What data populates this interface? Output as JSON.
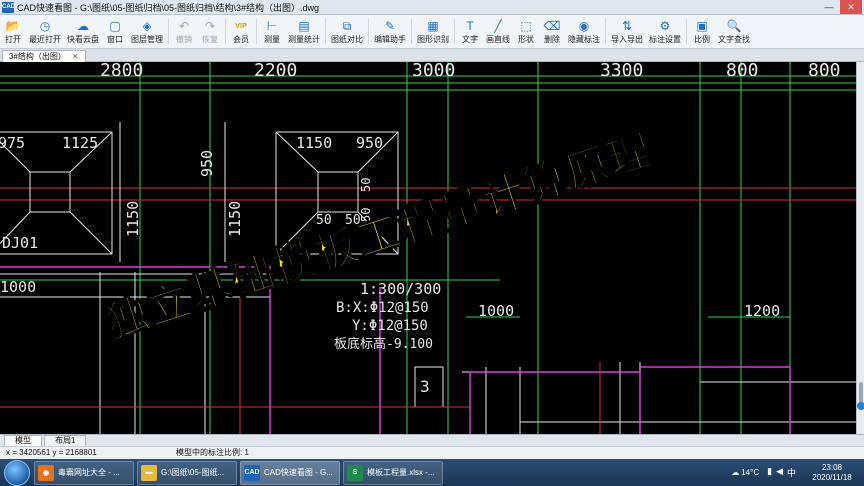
{
  "window": {
    "logo_text": "CAD",
    "title": "CAD快速看图 - G:\\图纸\\05-图纸归档\\05-图纸归档\\结构\\3#结构（出图）.dwg",
    "minimize": "—",
    "close": "✕"
  },
  "toolbar": {
    "items": [
      {
        "label": "打开",
        "icon": "folder-open-icon",
        "glyph": "📂"
      },
      {
        "label": "最近打开",
        "icon": "recent-icon",
        "glyph": "◷"
      },
      {
        "label": "快看云盘",
        "icon": "cloud-icon",
        "glyph": "☁"
      },
      {
        "label": "窗口",
        "icon": "window-icon",
        "glyph": "▢"
      },
      {
        "label": "图层管理",
        "icon": "layers-icon",
        "glyph": "◈"
      },
      {
        "label": "撤销",
        "icon": "undo-icon",
        "glyph": "↶",
        "disabled": true
      },
      {
        "label": "恢复",
        "icon": "redo-icon",
        "glyph": "↷",
        "disabled": true
      },
      {
        "label": "会员",
        "icon": "vip-icon",
        "glyph": "VIP"
      },
      {
        "label": "测量",
        "icon": "measure-icon",
        "glyph": "⊢"
      },
      {
        "label": "测量统计",
        "icon": "measure-stats-icon",
        "glyph": "▤"
      },
      {
        "label": "图纸对比",
        "icon": "compare-icon",
        "glyph": "⧉"
      },
      {
        "label": "编辑助手",
        "icon": "edit-helper-icon",
        "glyph": "✎"
      },
      {
        "label": "图形识别",
        "icon": "shape-recognize-icon",
        "glyph": "▦"
      },
      {
        "label": "文字",
        "icon": "text-icon",
        "glyph": "T"
      },
      {
        "label": "画直线",
        "icon": "line-icon",
        "glyph": "╱"
      },
      {
        "label": "形状",
        "icon": "shape-icon",
        "glyph": "⬚"
      },
      {
        "label": "删除",
        "icon": "eraser-icon",
        "glyph": "⌫"
      },
      {
        "label": "隐藏标注",
        "icon": "hide-annotation-icon",
        "glyph": "◉"
      },
      {
        "label": "导入导出",
        "icon": "import-export-icon",
        "glyph": "⇅"
      },
      {
        "label": "标注设置",
        "icon": "annotation-settings-icon",
        "glyph": "⚙"
      },
      {
        "label": "比例",
        "icon": "scale-icon",
        "glyph": "▣"
      },
      {
        "label": "文字查找",
        "icon": "text-search-icon",
        "glyph": "🔍"
      }
    ]
  },
  "doc_tab": {
    "label": "3#结构（出图）",
    "close": "✕"
  },
  "drawing": {
    "dims_top": [
      "2800",
      "2200",
      "3000",
      "3300",
      "800",
      "800"
    ],
    "left_footing": {
      "dims": [
        "975",
        "1125"
      ],
      "vdims": [
        "950",
        "1150"
      ],
      "tag": "DJ01"
    },
    "mid_footing": {
      "dims": [
        "1150",
        "950"
      ],
      "vdims": [
        "950",
        "1150"
      ],
      "small": [
        "50",
        "50",
        "50",
        "50"
      ]
    },
    "mid_dims": [
      "1000",
      "1000",
      "1200"
    ],
    "notes": [
      "1:300/300",
      "B:X:Φ12@150",
      "Y:Φ12@150",
      "板底标高-9.100"
    ],
    "label_3": "3"
  },
  "overlay_title": "独立基础模板工程量计算原理",
  "layout_tabs": [
    "模型",
    "布局1"
  ],
  "status": {
    "coords": "x = 3420561  y = 2168801",
    "scale": "模型中的标注比例: 1"
  },
  "taskbar": {
    "items": [
      {
        "label": "毒霸网址大全 - ...",
        "color": "#e2741e",
        "glyph": "◉"
      },
      {
        "label": "G:\\图纸\\05-图纸...",
        "color": "#e6b93a",
        "glyph": "▬"
      },
      {
        "label": "CAD快速看图 - G...",
        "color": "#1e63b8",
        "glyph": "CAD",
        "active": true
      },
      {
        "label": "模板工程量.xlsx -...",
        "color": "#1f8a4c",
        "glyph": "S"
      }
    ],
    "weather": "14°C",
    "time": "23:08",
    "date": "2020/11/18"
  },
  "colors": {
    "canvas": "#000000",
    "green_lines": "#37d24a",
    "white_lines": "#e8e8e8",
    "magenta": "#d640d6",
    "red": "#d23232",
    "overlay": "#f7e31a"
  }
}
